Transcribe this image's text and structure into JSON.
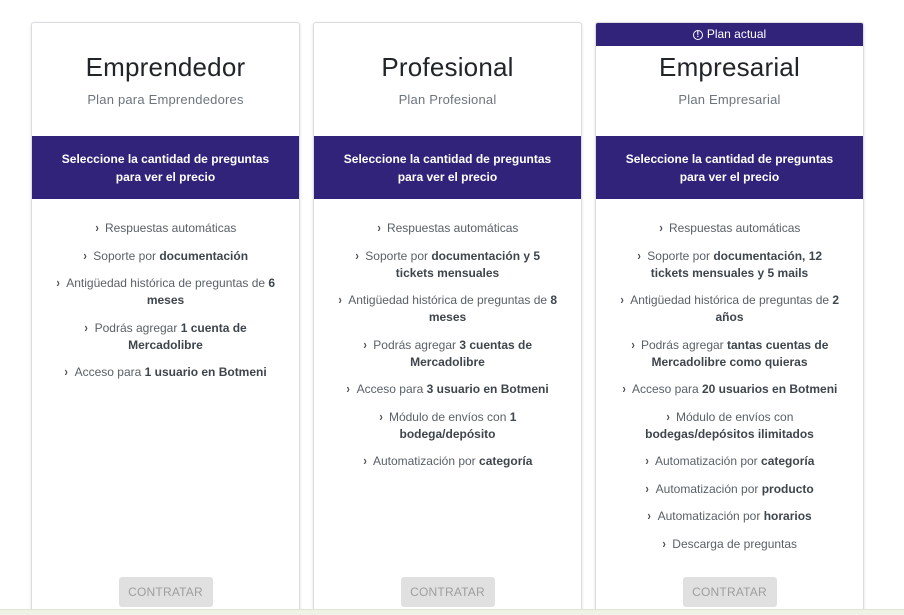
{
  "badge": {
    "label": "Plan actual",
    "icon": "info-icon"
  },
  "price_prompt": "Seleccione la cantidad de preguntas\npara ver el precio",
  "button_label": "CONTRATAR",
  "colors": {
    "accent": "#31237a",
    "button_bg": "#e0e0e0",
    "button_text": "#9e9e9e"
  },
  "plans": [
    {
      "title": "Emprendedor",
      "subtitle": "Plan para Emprendedores",
      "features": [
        [
          {
            "t": "Respuestas automáticas"
          }
        ],
        [
          {
            "t": "Soporte por "
          },
          {
            "t": "documentación",
            "b": true
          }
        ],
        [
          {
            "t": "Antigüedad histórica de preguntas de "
          },
          {
            "t": "6 meses",
            "b": true
          }
        ],
        [
          {
            "t": "Podrás agregar "
          },
          {
            "t": "1 cuenta de Mercadolibre",
            "b": true
          }
        ],
        [
          {
            "t": "Acceso para "
          },
          {
            "t": "1 usuario en Botmeni",
            "b": true
          }
        ]
      ]
    },
    {
      "title": "Profesional",
      "subtitle": "Plan Profesional",
      "features": [
        [
          {
            "t": "Respuestas automáticas"
          }
        ],
        [
          {
            "t": "Soporte por "
          },
          {
            "t": "documentación y 5 tickets mensuales",
            "b": true
          }
        ],
        [
          {
            "t": "Antigüedad histórica de preguntas de "
          },
          {
            "t": "8 meses",
            "b": true
          }
        ],
        [
          {
            "t": "Podrás agregar "
          },
          {
            "t": "3 cuentas de Mercadolibre",
            "b": true
          }
        ],
        [
          {
            "t": "Acceso para "
          },
          {
            "t": "3 usuario en Botmeni",
            "b": true
          }
        ],
        [
          {
            "t": "Módulo de envíos con "
          },
          {
            "t": "1 bodega/depósito",
            "b": true
          }
        ],
        [
          {
            "t": "Automatización por "
          },
          {
            "t": "categoría",
            "b": true
          }
        ]
      ]
    },
    {
      "title": "Empresarial",
      "subtitle": "Plan Empresarial",
      "current": true,
      "features": [
        [
          {
            "t": "Respuestas automáticas"
          }
        ],
        [
          {
            "t": "Soporte por "
          },
          {
            "t": "documentación, 12 tickets mensuales y 5 mails",
            "b": true
          }
        ],
        [
          {
            "t": "Antigüedad histórica de preguntas de "
          },
          {
            "t": "2 años",
            "b": true
          }
        ],
        [
          {
            "t": "Podrás agregar "
          },
          {
            "t": "tantas cuentas de Mercadolibre como quieras",
            "b": true
          }
        ],
        [
          {
            "t": "Acceso para "
          },
          {
            "t": "20 usuarios en Botmeni",
            "b": true
          }
        ],
        [
          {
            "t": "Módulo de envíos con "
          },
          {
            "t": "bodegas/depósitos ilimitados",
            "b": true
          }
        ],
        [
          {
            "t": "Automatización por "
          },
          {
            "t": "categoría",
            "b": true
          }
        ],
        [
          {
            "t": "Automatización por "
          },
          {
            "t": "producto",
            "b": true
          }
        ],
        [
          {
            "t": "Automatización por "
          },
          {
            "t": "horarios",
            "b": true
          }
        ],
        [
          {
            "t": "Descarga de preguntas"
          }
        ]
      ]
    }
  ]
}
